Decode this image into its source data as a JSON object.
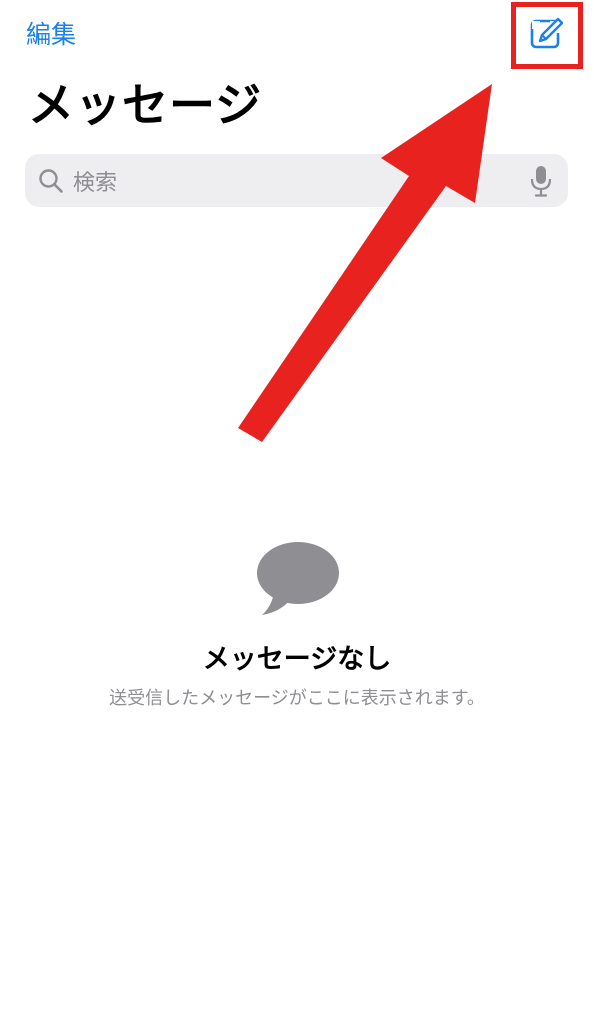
{
  "header": {
    "edit_label": "編集",
    "compose_icon": "square-and-pencil-icon",
    "title": "メッセージ"
  },
  "search": {
    "placeholder": "検索",
    "search_icon": "magnifying-glass-icon",
    "mic_icon": "microphone-icon"
  },
  "annotation": {
    "highlight_color": "#e8231f",
    "arrow_color": "#e8231f"
  },
  "empty_state": {
    "icon": "speech-bubble-icon",
    "title": "メッセージなし",
    "subtitle": "送受信したメッセージがここに表示されます。"
  },
  "colors": {
    "accent": "#1a7ff0",
    "secondary_text": "#8e8e93",
    "search_bg": "#eeeef0",
    "bubble": "#8e8e93"
  }
}
